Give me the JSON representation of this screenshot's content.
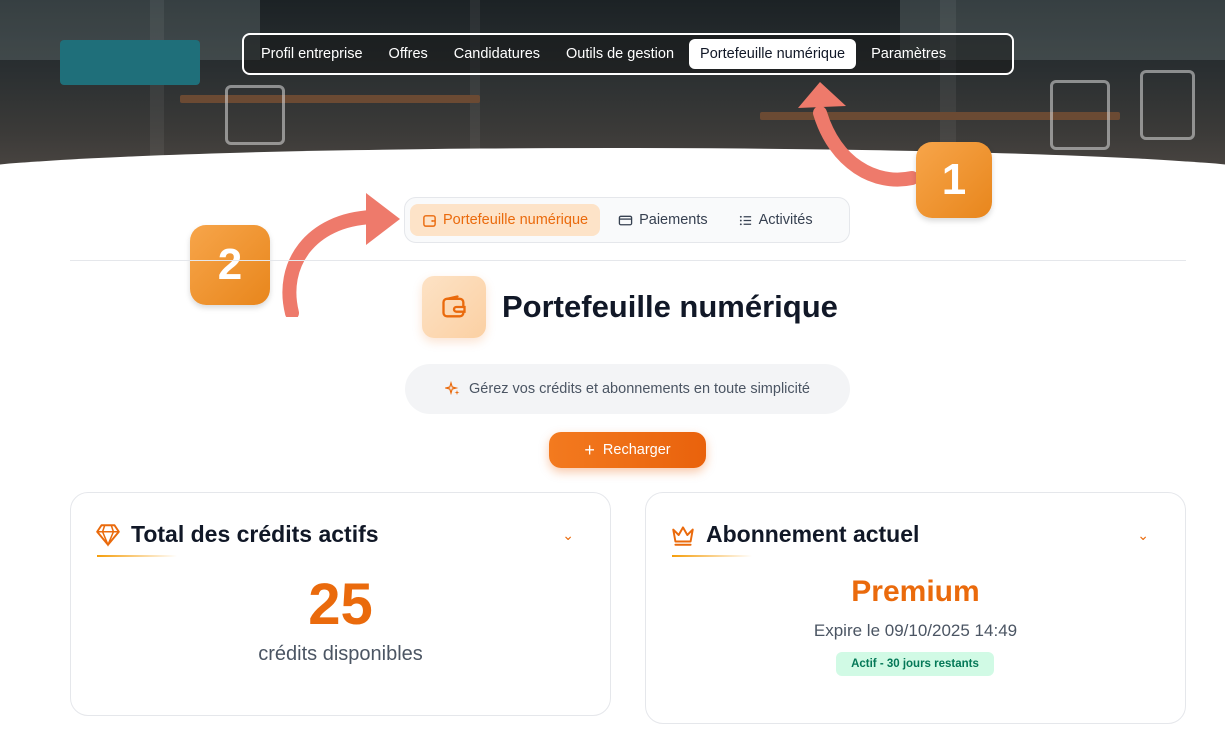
{
  "top_nav": {
    "items": [
      {
        "label": "Profil entreprise"
      },
      {
        "label": "Offres"
      },
      {
        "label": "Candidatures"
      },
      {
        "label": "Outils de gestion"
      },
      {
        "label": "Portefeuille numérique"
      },
      {
        "label": "Paramètres"
      }
    ],
    "active_index": 4
  },
  "steps": {
    "step1": "1",
    "step2": "2"
  },
  "sub_tabs": {
    "items": [
      {
        "label": "Portefeuille numérique",
        "icon": "wallet-icon"
      },
      {
        "label": "Paiements",
        "icon": "credit-card-icon"
      },
      {
        "label": "Activités",
        "icon": "list-icon"
      }
    ],
    "active_index": 0
  },
  "page": {
    "title": "Portefeuille numérique",
    "subtitle": "Gérez vos crédits et abonnements en toute simplicité",
    "recharge_label": "Recharger"
  },
  "credits_card": {
    "title": "Total des crédits actifs",
    "value": "25",
    "label": "crédits disponibles"
  },
  "subscription_card": {
    "title": "Abonnement actuel",
    "plan": "Premium",
    "expires": "Expire le 09/10/2025 14:49",
    "status": "Actif - 30 jours restants"
  },
  "colors": {
    "accent": "#ea6a0c",
    "badge": "#f0962f",
    "arrow": "#ee7a6b",
    "status_bg": "#d1fae5",
    "status_text": "#047857"
  }
}
